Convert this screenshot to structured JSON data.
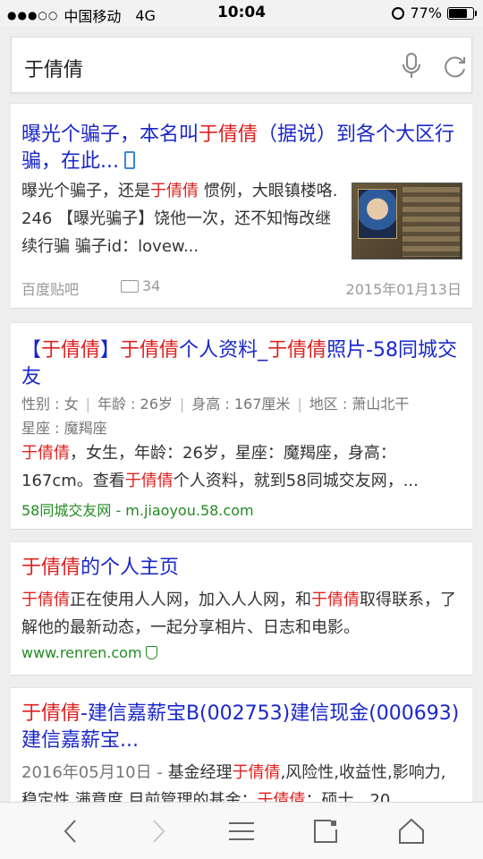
{
  "status": {
    "carrier": "中国移动",
    "network": "4G",
    "time": "10:04",
    "battery": "77%",
    "battery_level": 0.77
  },
  "search": {
    "query": "于倩倩",
    "icons": [
      "microphone-icon",
      "refresh-icon"
    ]
  },
  "results": [
    {
      "title_parts": [
        "曝光个骗子，本名叫",
        "于倩倩",
        "（据说）到各个大区行骗，在此..."
      ],
      "snippet_parts": [
        "曝光个骗子，还是",
        "于倩倩",
        " 惯例，大眼镇楼咯. 246 【曝光骗子】饶他一次，还不知悔改继续行骗 骗子id：lovew..."
      ],
      "source": "百度贴吧",
      "comments": "34",
      "date": "2015年01月13日"
    },
    {
      "title_parts": [
        "【",
        "于倩倩",
        "】",
        "于倩倩",
        "个人资料_",
        "于倩倩",
        "照片-58同城交友"
      ],
      "meta": [
        "性别 : 女",
        "年龄 : 26岁",
        "身高 : 167厘米",
        "地区 : 萧山北干",
        "星座 : 魔羯座"
      ],
      "snippet_parts": [
        "于倩倩",
        "，女生，年龄：26岁，星座：魔羯座，身高：167cm。查看",
        "于倩倩",
        "个人资料，就到58同城交友网，..."
      ],
      "url": "58同城交友网 - m.jiaoyou.58.com"
    },
    {
      "title_parts": [
        "于倩倩",
        "的个人主页"
      ],
      "snippet_parts": [
        "于倩倩",
        "正在使用人人网，加入人人网，和",
        "于倩倩",
        "取得联系，了解他的最新动态，一起分享相片、日志和电影。"
      ],
      "url": "www.renren.com"
    },
    {
      "title_parts": [
        "于倩倩",
        "-建信嘉薪宝B(002753)建信现金(000693)建信嘉薪宝..."
      ],
      "snippet_parts": [
        "2016年05月10日 - ",
        "基金经理",
        "于倩倩",
        ",风险性,收益性,影响力,稳定性,满意度,目前管理的基金：",
        "于倩倩",
        "：硕士，20"
      ]
    }
  ],
  "toolbar": {
    "icons": [
      "back-icon",
      "forward-icon",
      "menu-icon",
      "tabs-icon",
      "home-icon"
    ]
  },
  "colors": {
    "title_blue": "#1a27c9",
    "highlight_red": "#e02020",
    "url_green": "#228b22"
  }
}
